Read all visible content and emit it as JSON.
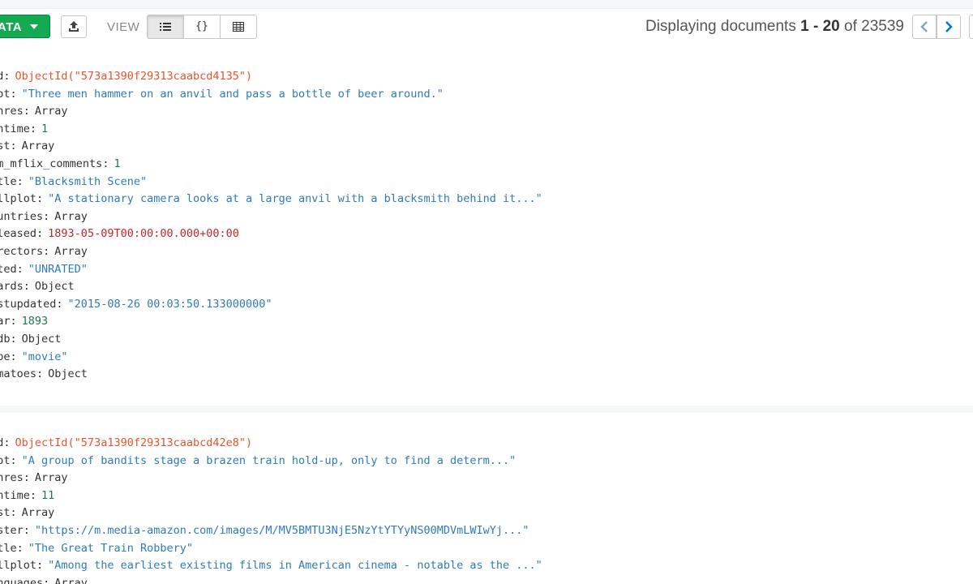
{
  "toolbar": {
    "add_data_label": "ATA",
    "view_label": "VIEW",
    "json_view_glyph": "{}",
    "paging": {
      "prefix": "Displaying documents",
      "start": "1",
      "dash": "-",
      "end": "20",
      "of": "of",
      "total": "23539"
    }
  },
  "icons": {
    "add_caret": "caret-down-icon",
    "import": "upload-icon",
    "list_view": "list-icon",
    "json_view": "braces-icon",
    "table_view": "table-icon",
    "prev_page": "chevron-left-icon",
    "next_page": "chevron-right-icon"
  },
  "colors": {
    "accent_green": "#13aa52",
    "string_value": "#2f7bb8",
    "number_value": "#1e7a4a",
    "objectid_value": "#e8542c",
    "date_value": "#c0282b",
    "pager_arrow": "#0077c8"
  },
  "documents": [
    {
      "fields": [
        {
          "key": "_id",
          "value": "ObjectId(\"573a1390f29313caabcd4135\")",
          "type": "oid"
        },
        {
          "key": "plot",
          "value": "\"Three men hammer on an anvil and pass a bottle of beer around.\"",
          "type": "str"
        },
        {
          "key": "genres",
          "value": "Array",
          "type": "type"
        },
        {
          "key": "runtime",
          "value": "1",
          "type": "num"
        },
        {
          "key": "cast",
          "value": "Array",
          "type": "type"
        },
        {
          "key": "num_mflix_comments",
          "value": "1",
          "type": "num"
        },
        {
          "key": "title",
          "value": "\"Blacksmith Scene\"",
          "type": "str"
        },
        {
          "key": "fullplot",
          "value": "\"A stationary camera looks at a large anvil with a blacksmith behind it...\"",
          "type": "str"
        },
        {
          "key": "countries",
          "value": "Array",
          "type": "type"
        },
        {
          "key": "released",
          "value": "1893-05-09T00:00:00.000+00:00",
          "type": "date"
        },
        {
          "key": "directors",
          "value": "Array",
          "type": "type"
        },
        {
          "key": "rated",
          "value": "\"UNRATED\"",
          "type": "str"
        },
        {
          "key": "awards",
          "value": "Object",
          "type": "type"
        },
        {
          "key": "lastupdated",
          "value": "\"2015-08-26 00:03:50.133000000\"",
          "type": "str"
        },
        {
          "key": "year",
          "value": "1893",
          "type": "num"
        },
        {
          "key": "imdb",
          "value": "Object",
          "type": "type"
        },
        {
          "key": "type",
          "value": "\"movie\"",
          "type": "str"
        },
        {
          "key": "tomatoes",
          "value": "Object",
          "type": "type"
        }
      ]
    },
    {
      "fields": [
        {
          "key": "_id",
          "value": "ObjectId(\"573a1390f29313caabcd42e8\")",
          "type": "oid"
        },
        {
          "key": "plot",
          "value": "\"A group of bandits stage a brazen train hold-up, only to find a determ...\"",
          "type": "str"
        },
        {
          "key": "genres",
          "value": "Array",
          "type": "type"
        },
        {
          "key": "runtime",
          "value": "11",
          "type": "num"
        },
        {
          "key": "cast",
          "value": "Array",
          "type": "type"
        },
        {
          "key": "poster",
          "value": "\"https://m.media-amazon.com/images/M/MV5BMTU3NjE5NzYtYTYyNS00MDVmLWIwYj...\"",
          "type": "str"
        },
        {
          "key": "title",
          "value": "\"The Great Train Robbery\"",
          "type": "str"
        },
        {
          "key": "fullplot",
          "value": "\"Among the earliest existing films in American cinema - notable as the ...\"",
          "type": "str"
        },
        {
          "key": "languages",
          "value": "Array",
          "type": "type"
        }
      ]
    }
  ]
}
